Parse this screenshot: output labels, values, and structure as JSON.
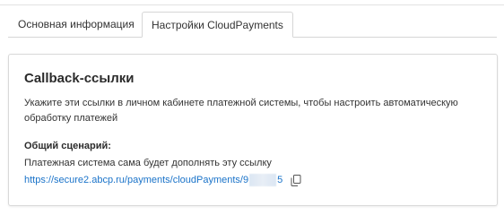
{
  "tabs": [
    {
      "label": "Основная информация",
      "active": false
    },
    {
      "label": "Настройки CloudPayments",
      "active": true
    }
  ],
  "card": {
    "title": "Callback-ссылки",
    "description": "Укажите эти ссылки в личном кабинете платежной системы, чтобы настроить автоматическую обработку платежей",
    "scenario": {
      "title": "Общий сценарий:",
      "description": "Платежная система сама будет дополнять эту ссылку",
      "url_start": "https://secure2.abcp.ru/payments/cloudPayments/9",
      "url_end": "5",
      "copy_icon": "copy-icon"
    }
  },
  "colors": {
    "link": "#1a73c9",
    "border": "#d9d9d9",
    "text": "#333333"
  }
}
